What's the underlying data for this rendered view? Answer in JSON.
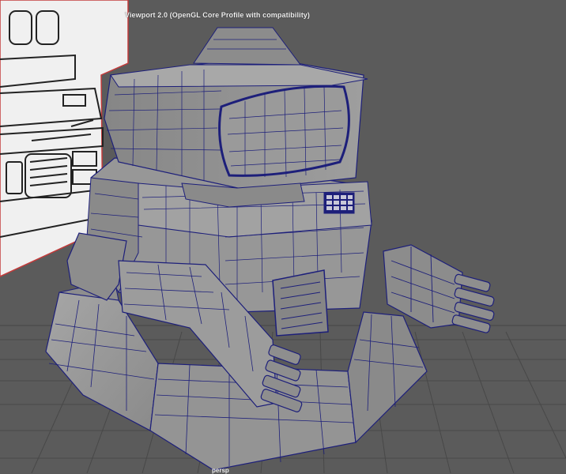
{
  "viewport": {
    "renderer_label": "Viewport 2.0 (OpenGL Core Profile with compatibility)",
    "camera_label": "persp"
  },
  "scene": {
    "object": "robot-model",
    "display_mode": "wireframe-on-shaded",
    "reference_image_plane": "robot-sketch"
  },
  "colors": {
    "viewport_bg": "#5b5b5b",
    "grid": "#4a4a4a",
    "grid_axis": "#3a3a3a",
    "mesh_fill": "#9a9a9a",
    "mesh_shadow": "#7c7c7c",
    "wire": "#1d1f7a",
    "plane_fill": "#f2f2f2",
    "plane_edge": "#c23b3b"
  }
}
